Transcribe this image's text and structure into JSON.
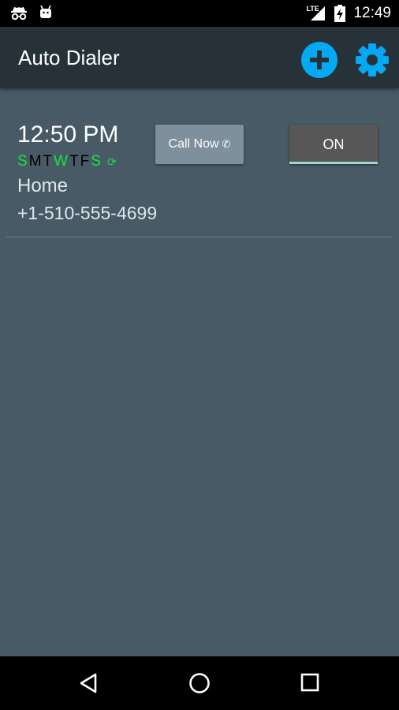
{
  "status": {
    "time": "12:49",
    "network": "LTE"
  },
  "app": {
    "title": "Auto Dialer",
    "icons": [
      "add-icon",
      "settings-gear-icon"
    ],
    "accent_color": "#03a9f4"
  },
  "alarm": {
    "time": "12:50 PM",
    "days": [
      {
        "letter": "S",
        "active": true
      },
      {
        "letter": "M",
        "active": false
      },
      {
        "letter": "T",
        "active": false
      },
      {
        "letter": "W",
        "active": true
      },
      {
        "letter": "T",
        "active": false
      },
      {
        "letter": "F",
        "active": false
      },
      {
        "letter": "S",
        "active": true
      }
    ],
    "repeat_symbol": "⟳",
    "label": "Home",
    "phone": "+1-510-555-4699",
    "call_button": {
      "label": "Call Now",
      "icon": "✆"
    },
    "toggle": {
      "state": "ON"
    },
    "active_day_color": "#19e43a"
  },
  "nav": {
    "icons": [
      "back-icon",
      "home-icon",
      "recents-icon"
    ]
  }
}
